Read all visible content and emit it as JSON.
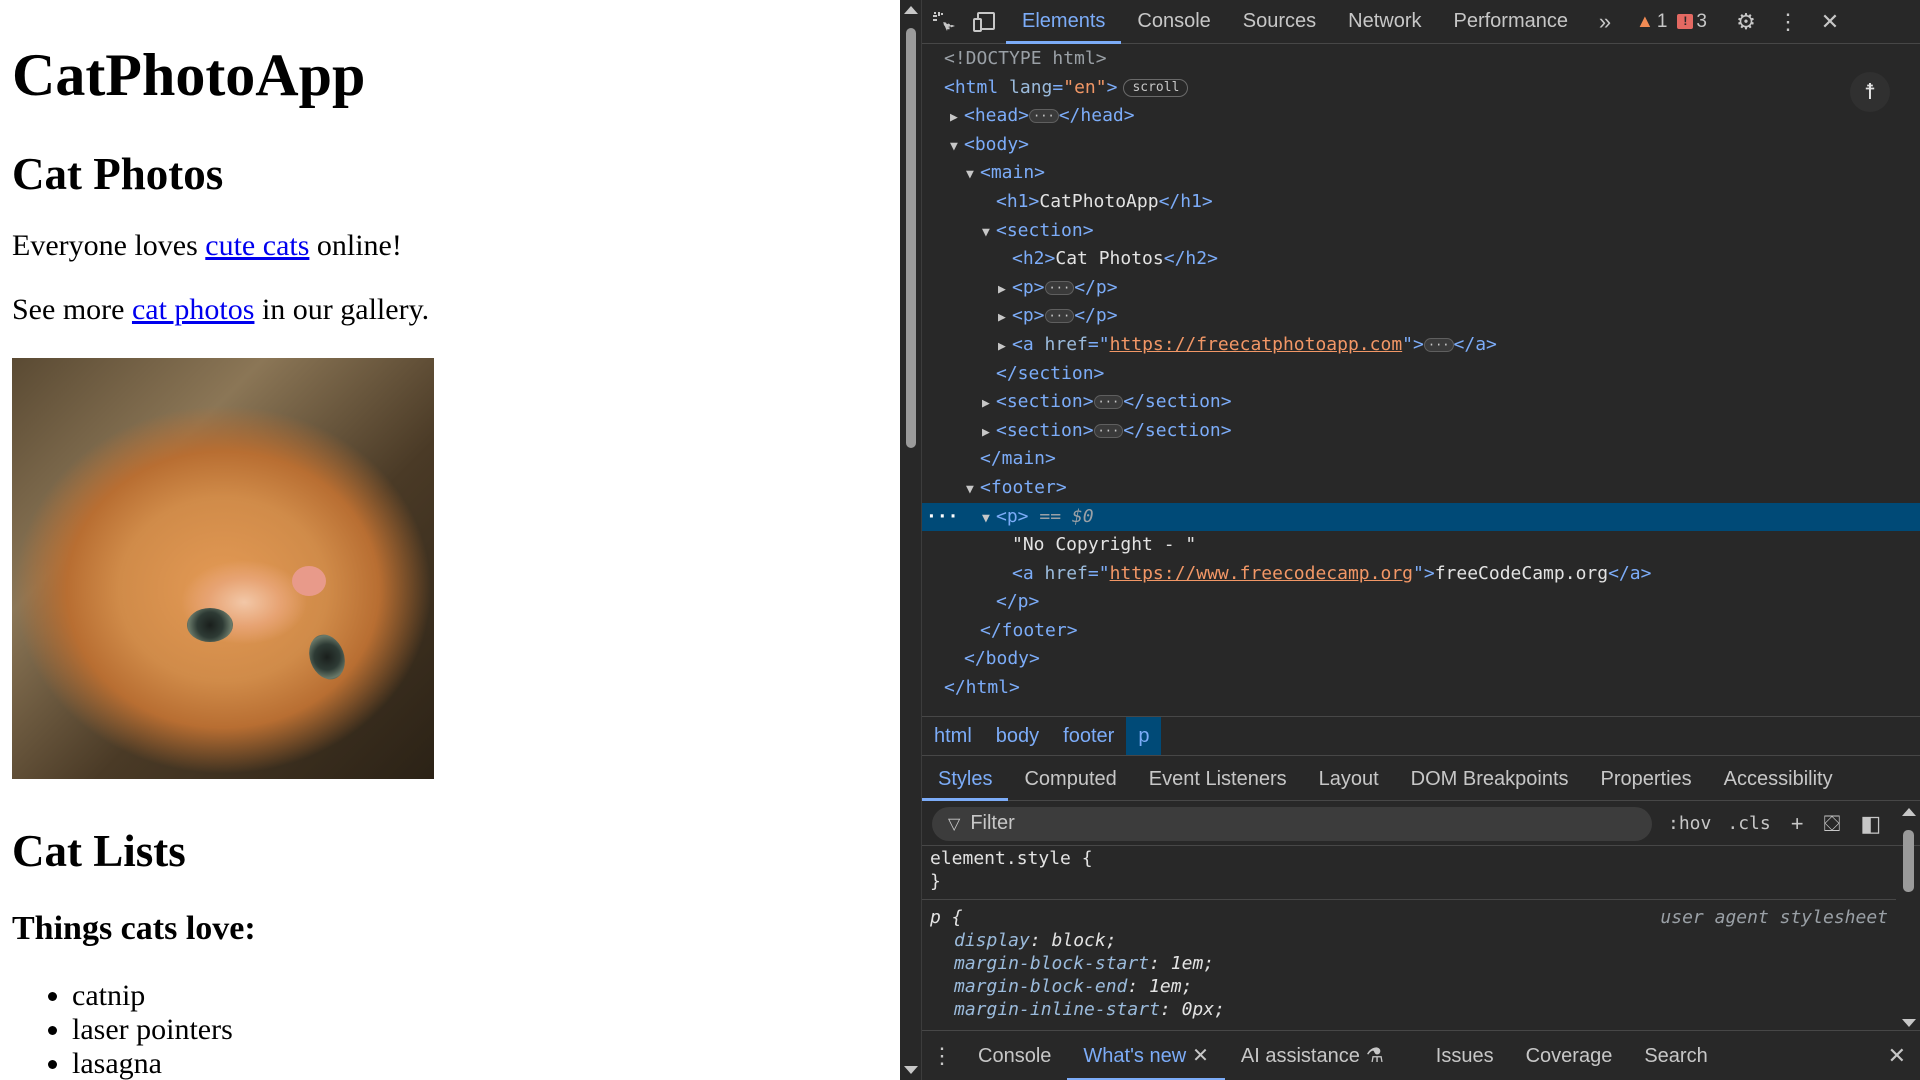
{
  "page": {
    "h1": "CatPhotoApp",
    "h2_photos": "Cat Photos",
    "p1_before": "Everyone loves ",
    "p1_link": "cute cats",
    "p1_after": " online!",
    "p2_before": "See more ",
    "p2_link": "cat photos",
    "p2_after": " in our gallery.",
    "h2_lists": "Cat Lists",
    "h3_love": "Things cats love:",
    "love_items": [
      "catnip",
      "laser pointers",
      "lasagna"
    ]
  },
  "devtools": {
    "tabs": [
      "Elements",
      "Console",
      "Sources",
      "Network",
      "Performance"
    ],
    "active_tab": "Elements",
    "warnings": "1",
    "errors": "3",
    "tree": {
      "doctype": "<!DOCTYPE html>",
      "html_open": "<html",
      "lang_attr": "lang",
      "lang_val": "\"en\"",
      "scroll_badge": "scroll",
      "h1_text": "CatPhotoApp",
      "h2_text": "Cat Photos",
      "href1": "https://freecatphotoapp.com",
      "selected_suffix": "== $0",
      "copyright_text": "\"No Copyright - \"",
      "href2": "https://www.freecodecamp.org",
      "link2_text": "freeCodeCamp.org"
    },
    "breadcrumbs": [
      "html",
      "body",
      "footer",
      "p"
    ],
    "subtabs": [
      "Styles",
      "Computed",
      "Event Listeners",
      "Layout",
      "DOM Breakpoints",
      "Properties",
      "Accessibility"
    ],
    "filter_placeholder": "Filter",
    "hov": ":hov",
    "cls": ".cls",
    "styles": {
      "element_style": "element.style {",
      "close_brace": "}",
      "p_selector": "p {",
      "source": "user agent stylesheet",
      "rules": [
        {
          "prop": "display",
          "val": "block;"
        },
        {
          "prop": "margin-block-start",
          "val": "1em;"
        },
        {
          "prop": "margin-block-end",
          "val": "1em;"
        },
        {
          "prop": "margin-inline-start",
          "val": "0px;"
        }
      ]
    },
    "drawer_tabs": [
      "Console",
      "What's new",
      "AI assistance",
      "Issues",
      "Coverage",
      "Search"
    ],
    "drawer_active": "What's new"
  },
  "colors": {
    "devtools_bg": "#282828",
    "accent": "#7cacf8",
    "selected_row": "#004a77",
    "link": "#0000ee"
  }
}
